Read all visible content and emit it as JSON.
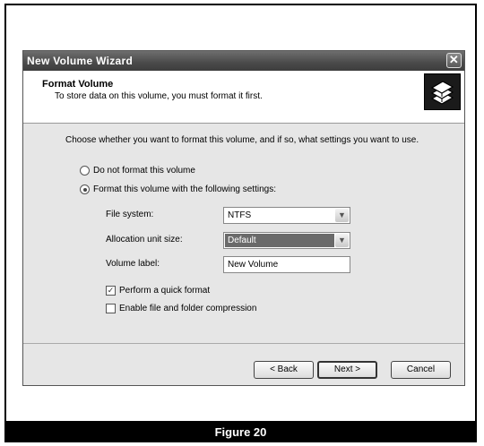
{
  "window": {
    "title": "New Volume Wizard",
    "close_glyph": "✕"
  },
  "header": {
    "title": "Format Volume",
    "subtitle": "To store data on this volume, you must format it first.",
    "icon": "disk-stack-icon"
  },
  "content": {
    "intro": "Choose whether you want to format this volume, and if so, what settings you want to use.",
    "radio_no_format": "Do not format this volume",
    "radio_format": "Format this volume with the following settings:",
    "selected_radio": "format",
    "file_system_label": "File system:",
    "file_system_value": "NTFS",
    "allocation_label": "Allocation unit size:",
    "allocation_value": "Default",
    "volume_label_label": "Volume label:",
    "volume_label_value": "New Volume",
    "quick_format_label": "Perform a quick format",
    "quick_format_checked": true,
    "compression_label": "Enable file and folder compression",
    "compression_checked": false
  },
  "buttons": {
    "back": "< Back",
    "next": "Next >",
    "cancel": "Cancel"
  },
  "caption": "Figure 20"
}
